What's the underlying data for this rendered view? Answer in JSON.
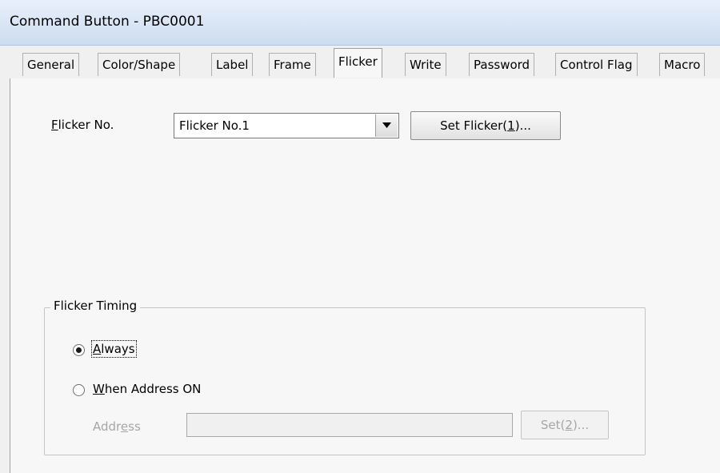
{
  "window": {
    "title": "Command Button - PBC0001"
  },
  "tabs": [
    {
      "label": "General"
    },
    {
      "label": "Color/Shape"
    },
    {
      "label": "Label"
    },
    {
      "label": "Frame"
    },
    {
      "label": "Flicker",
      "active": true
    },
    {
      "label": "Write"
    },
    {
      "label": "Password"
    },
    {
      "label": "Control Flag"
    },
    {
      "label": "Macro"
    }
  ],
  "flicker": {
    "no_label_mnemonic": "F",
    "no_label_rest": "licker No.",
    "selected": "Flicker No.1",
    "set_btn_prefix": "Set Flicker(",
    "set_btn_mnemonic": "1",
    "set_btn_suffix": ")..."
  },
  "timing": {
    "legend": "Flicker Timing",
    "always_mnemonic": "A",
    "always_rest": "lways",
    "always_selected": true,
    "when_mnemonic": "W",
    "when_rest": "hen Address ON",
    "address_prefix": "Addr",
    "address_mnemonic": "e",
    "address_suffix": "ss",
    "address_value": "",
    "set2_prefix": "Set(",
    "set2_mnemonic": "2",
    "set2_suffix": ")..."
  }
}
